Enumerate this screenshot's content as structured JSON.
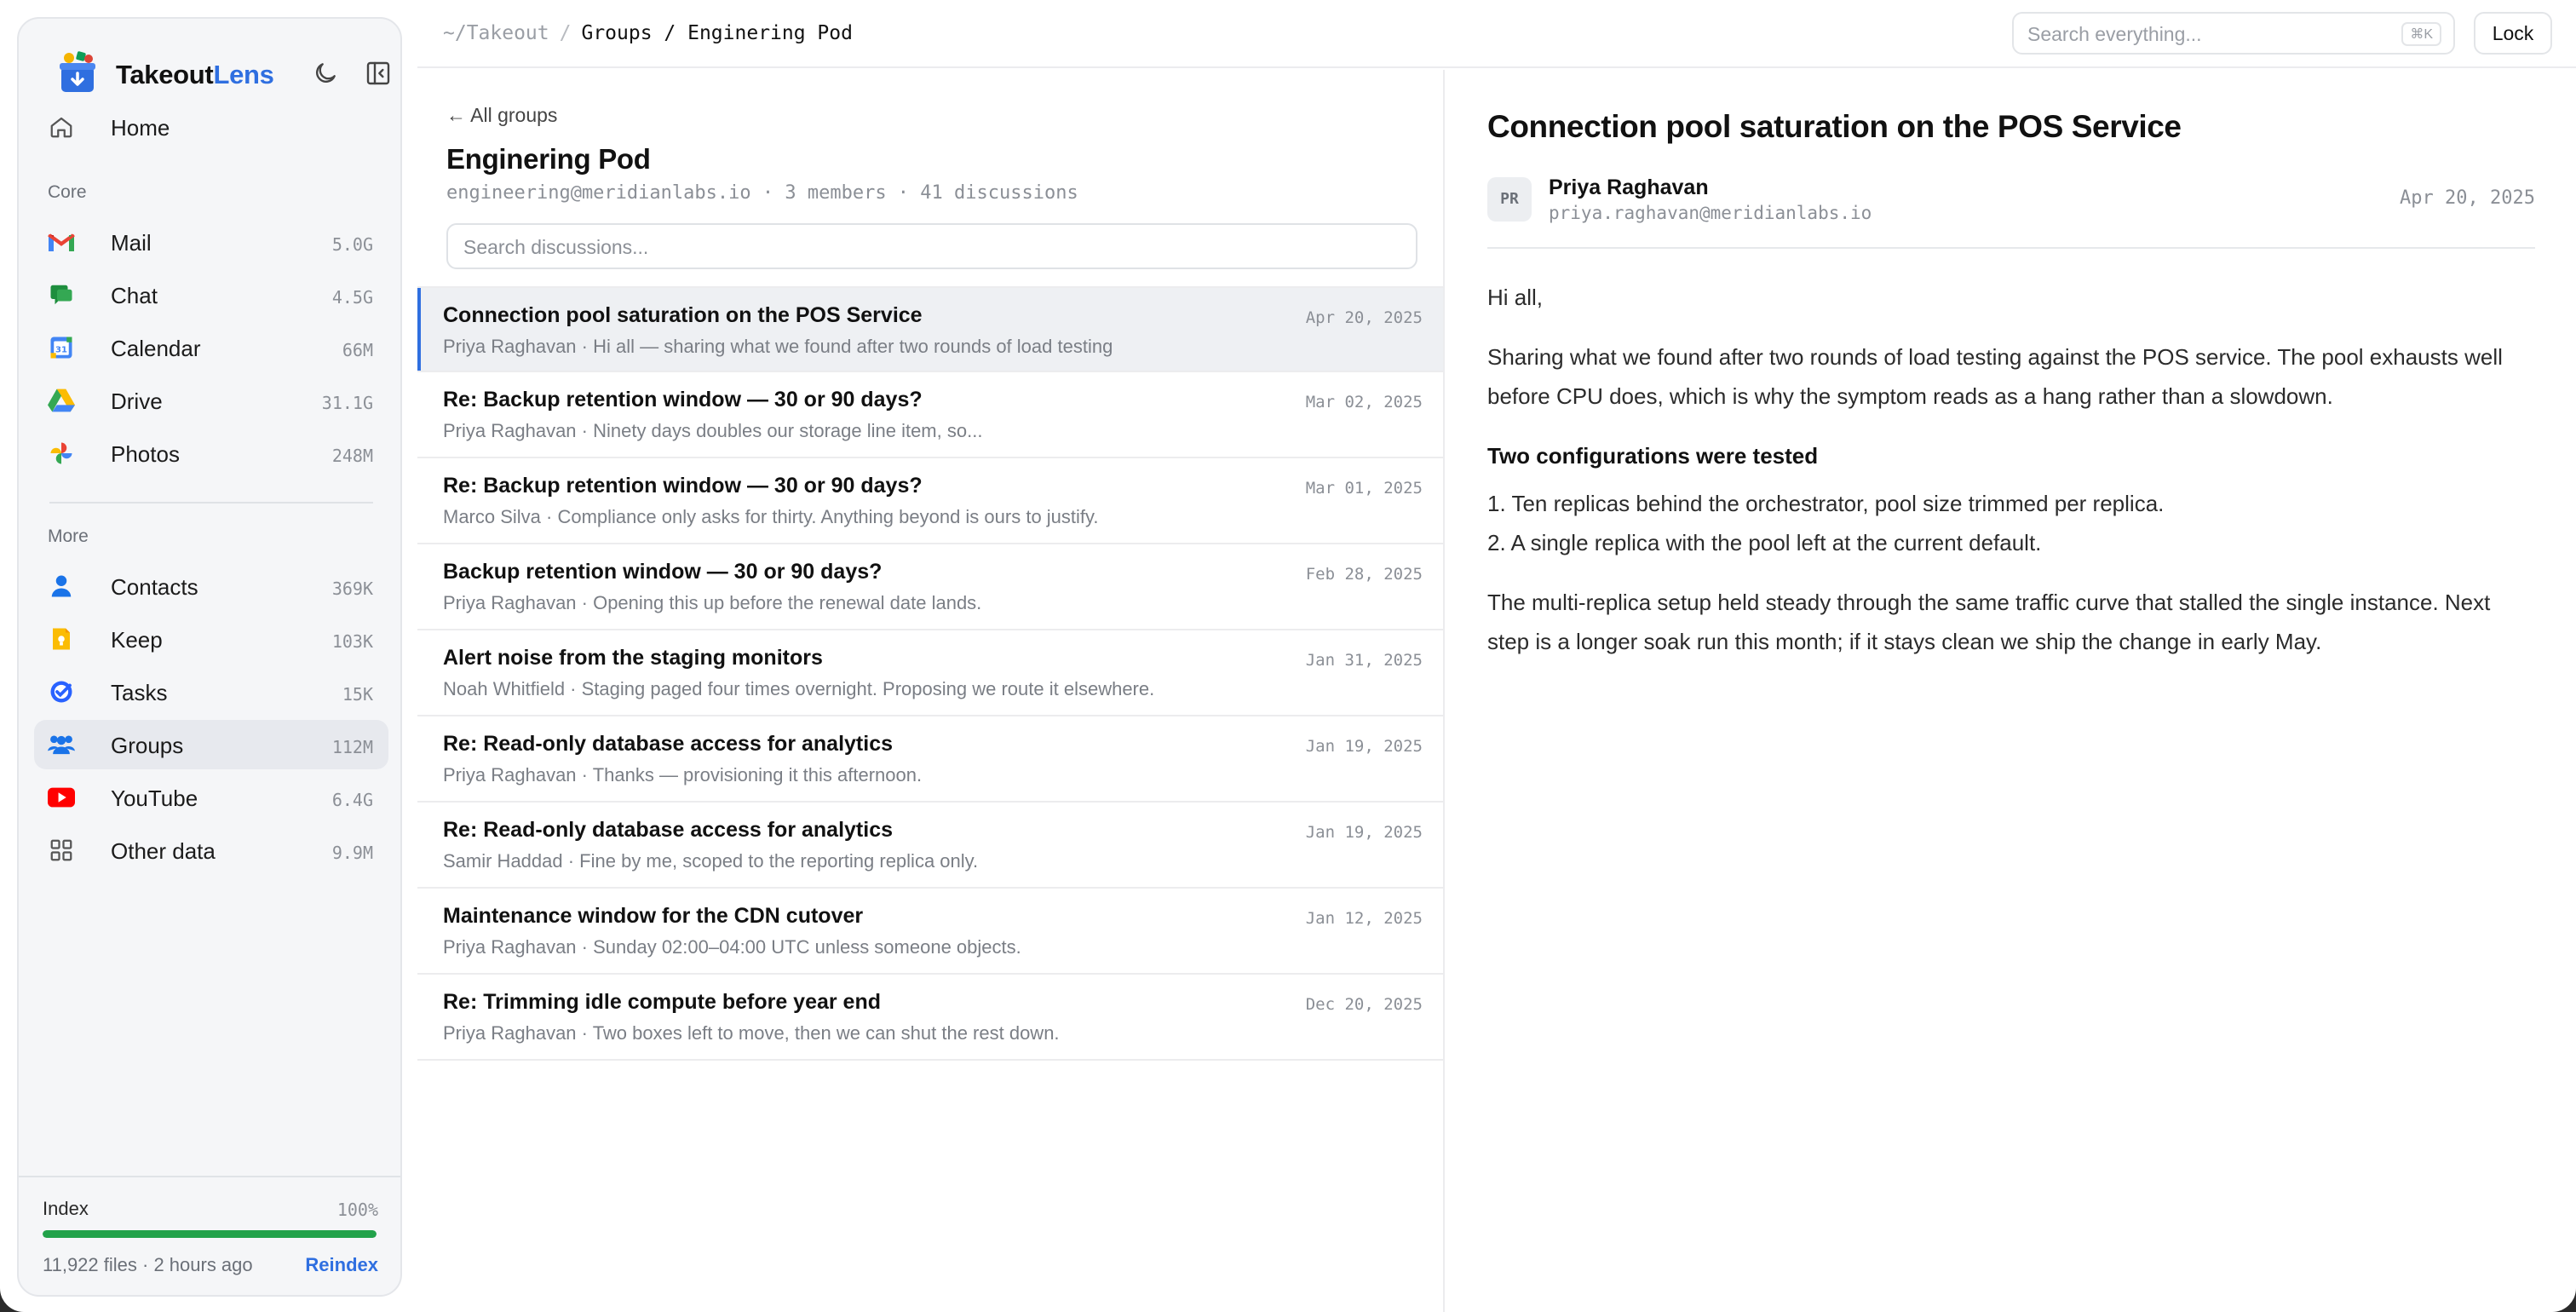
{
  "brand": {
    "name_part1": "Takeout",
    "name_part2": "Lens"
  },
  "sidebar": {
    "home": {
      "label": "Home"
    },
    "sections": {
      "core": "Core",
      "more": "More"
    },
    "core_items": [
      {
        "id": "mail",
        "label": "Mail",
        "size": "5.0G",
        "icon": "gmail-icon"
      },
      {
        "id": "chat",
        "label": "Chat",
        "size": "4.5G",
        "icon": "chat-icon"
      },
      {
        "id": "calendar",
        "label": "Calendar",
        "size": "66M",
        "icon": "calendar-icon",
        "icon_text": "31"
      },
      {
        "id": "drive",
        "label": "Drive",
        "size": "31.1G",
        "icon": "drive-icon"
      },
      {
        "id": "photos",
        "label": "Photos",
        "size": "248M",
        "icon": "photos-icon"
      }
    ],
    "more_items": [
      {
        "id": "contacts",
        "label": "Contacts",
        "size": "369K",
        "icon": "contacts-icon"
      },
      {
        "id": "keep",
        "label": "Keep",
        "size": "103K",
        "icon": "keep-icon"
      },
      {
        "id": "tasks",
        "label": "Tasks",
        "size": "15K",
        "icon": "tasks-icon"
      },
      {
        "id": "groups",
        "label": "Groups",
        "size": "112M",
        "icon": "groups-icon",
        "active": true
      },
      {
        "id": "youtube",
        "label": "YouTube",
        "size": "6.4G",
        "icon": "youtube-icon"
      },
      {
        "id": "other",
        "label": "Other data",
        "size": "9.9M",
        "icon": "grid-icon"
      }
    ],
    "index": {
      "label": "Index",
      "percent_text": "100%",
      "progress": 1.0,
      "files": "11,922 files · 2 hours ago",
      "reindex": "Reindex"
    }
  },
  "topbar": {
    "breadcrumb": {
      "root": "~/Takeout",
      "separator": "/",
      "current": "Groups / Enginering Pod"
    },
    "search": {
      "placeholder": "Search everything...",
      "shortcut": "⌘K"
    },
    "lock_label": "Lock"
  },
  "group": {
    "back_label": "← All groups",
    "title": "Enginering Pod",
    "meta": "engineering@meridianlabs.io · 3 members · 41 discussions",
    "search_placeholder": "Search discussions..."
  },
  "threads": [
    {
      "subject": "Connection pool saturation on the POS Service",
      "preview": "Priya Raghavan · Hi all — sharing what we found after two rounds of load testing",
      "date": "Apr 20, 2025",
      "active": true
    },
    {
      "subject": "Re: Backup retention window — 30 or 90 days?",
      "preview": "Priya Raghavan · Ninety days doubles our storage line item, so...",
      "date": "Mar 02, 2025"
    },
    {
      "subject": "Re: Backup retention window — 30 or 90 days?",
      "preview": "Marco Silva · Compliance only asks for thirty. Anything beyond is ours to justify.",
      "date": "Mar 01, 2025"
    },
    {
      "subject": "Backup retention window — 30 or 90 days?",
      "preview": "Priya Raghavan · Opening this up before the renewal date lands.",
      "date": "Feb 28, 2025"
    },
    {
      "subject": "Alert noise from the staging monitors",
      "preview": "Noah Whitfield · Staging paged four times overnight. Proposing we route it elsewhere.",
      "date": "Jan 31, 2025"
    },
    {
      "subject": "Re: Read-only database access for analytics",
      "preview": "Priya Raghavan · Thanks — provisioning it this afternoon.",
      "date": "Jan 19, 2025"
    },
    {
      "subject": "Re: Read-only database access for analytics",
      "preview": "Samir Haddad · Fine by me, scoped to the reporting replica only.",
      "date": "Jan 19, 2025"
    },
    {
      "subject": "Maintenance window for the CDN cutover",
      "preview": "Priya Raghavan · Sunday 02:00–04:00 UTC unless someone objects.",
      "date": "Jan 12, 2025"
    },
    {
      "subject": "Re: Trimming idle compute before year end",
      "preview": "Priya Raghavan · Two boxes left to move, then we can shut the rest down.",
      "date": "Dec 20, 2025"
    }
  ],
  "message": {
    "title": "Connection pool saturation on the POS Service",
    "author": {
      "initials": "PR",
      "name": "Priya Raghavan",
      "email": "priya.raghavan@meridianlabs.io"
    },
    "date": "Apr 20, 2025",
    "greeting": "Hi all,",
    "paragraph1": "Sharing what we found after two rounds of load testing against the POS service. The pool exhausts well before CPU does, which is why the symptom reads as a hang rather than a slowdown.",
    "heading": "Two configurations were tested",
    "list": [
      "1. Ten replicas behind the orchestrator, pool size trimmed per replica.",
      "2. A single replica with the pool left at the current default."
    ],
    "paragraph2": "The multi-replica setup held steady through the same traffic curve that stalled the single instance. Next step is a longer soak run this month; if it stays clean we ship the change in early May."
  },
  "colors": {
    "accent": "#2f6fe0",
    "progress": "#22a24a",
    "active_row": "#eef0f3"
  }
}
